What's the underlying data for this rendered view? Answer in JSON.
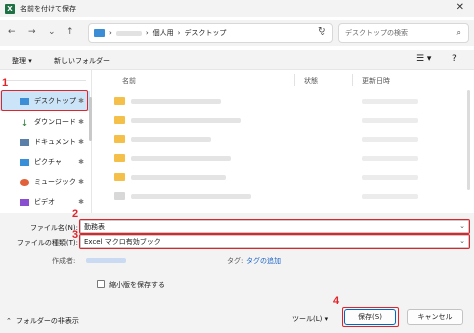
{
  "window": {
    "title": "名前を付けて保存",
    "app_icon": "X",
    "close": "✕"
  },
  "address_bar": {
    "separator": "›",
    "crumbs": [
      "個人用",
      "デスクトップ"
    ],
    "search_placeholder": "デスクトップの検索"
  },
  "toolbar": {
    "organize": "整理 ▾",
    "new_folder": "新しいフォルダー"
  },
  "nav": {
    "items": [
      {
        "label": "デスクトップ",
        "pinned": "✱"
      },
      {
        "label": "ダウンロード",
        "pinned": "✱"
      },
      {
        "label": "ドキュメント",
        "pinned": "✱"
      },
      {
        "label": "ピクチャ",
        "pinned": "✱"
      },
      {
        "label": "ミュージック",
        "pinned": "✱"
      },
      {
        "label": "ビデオ",
        "pinned": "✱"
      }
    ]
  },
  "columns": {
    "name": "名前",
    "status": "状態",
    "modified": "更新日時"
  },
  "form": {
    "filename_label": "ファイル名(N):",
    "filename_value": "勤務表",
    "filetype_label": "ファイルの種類(T):",
    "filetype_value": "Excel マクロ有効ブック",
    "author_label": "作成者:",
    "tag_label": "タグ:",
    "tag_link": "タグの追加",
    "thumbnail_label": "縮小版を保存する",
    "hide_folders": "フォルダーの非表示",
    "tools": "ツール(L)",
    "save": "保存(S)",
    "cancel": "キャンセル"
  },
  "annotations": [
    "1",
    "2",
    "3",
    "4"
  ],
  "colors": {
    "highlight": "#e0242a",
    "accent": "#0067c0",
    "excel": "#1e7145"
  }
}
